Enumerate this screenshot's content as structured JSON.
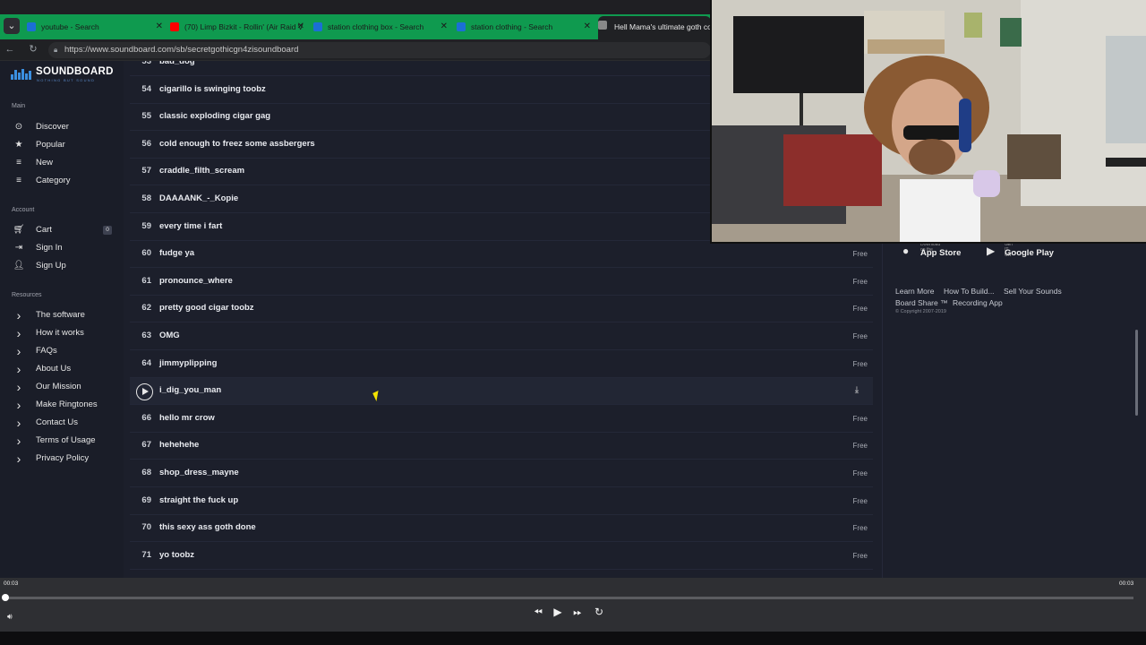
{
  "browser": {
    "tabs": [
      {
        "title": "youtube - Search",
        "color": "#1b6fd6"
      },
      {
        "title": "(70) Limp Bizkit - Rollin' (Air Raid V",
        "color": "#ff0000"
      },
      {
        "title": "station clothing box - Search",
        "color": "#1b6fd6"
      },
      {
        "title": "station clothing - Search",
        "color": "#1b6fd6"
      },
      {
        "title": "Hell Mama's ultimate goth cob",
        "color": "#888888"
      }
    ],
    "tab_close": "✕",
    "url": "https://www.soundboard.com/sb/secretgothicgn4zisoundboard"
  },
  "logo": {
    "word": "SOUNDBOARD",
    "tagline": "NOTHING BUT SOUND"
  },
  "sidebar": {
    "main_heading": "Main",
    "main": [
      {
        "label": "Discover",
        "icon": "compass-icon"
      },
      {
        "label": "Popular",
        "icon": "star-icon"
      },
      {
        "label": "New",
        "icon": "lines-icon"
      },
      {
        "label": "Category",
        "icon": "lines-icon"
      }
    ],
    "account_heading": "Account",
    "account": [
      {
        "label": "Cart",
        "icon": "cart-icon",
        "count": "0"
      },
      {
        "label": "Sign In",
        "icon": "sign-in-icon"
      },
      {
        "label": "Sign Up",
        "icon": "user-plus-icon"
      }
    ],
    "resources_heading": "Resources",
    "resources": [
      {
        "label": "The software"
      },
      {
        "label": "How it works"
      },
      {
        "label": "FAQs"
      },
      {
        "label": "About Us"
      },
      {
        "label": "Our Mission"
      },
      {
        "label": "Make Ringtones"
      },
      {
        "label": "Contact Us"
      },
      {
        "label": "Terms of Usage"
      },
      {
        "label": "Privacy Policy"
      }
    ]
  },
  "sounds": [
    {
      "num": "53",
      "name": "bad_dog",
      "price": ""
    },
    {
      "num": "54",
      "name": "cigarillo is swinging toobz",
      "price": ""
    },
    {
      "num": "55",
      "name": "classic exploding cigar gag",
      "price": ""
    },
    {
      "num": "56",
      "name": "cold enough to freez some assbergers",
      "price": ""
    },
    {
      "num": "57",
      "name": "craddle_filth_scream",
      "price": ""
    },
    {
      "num": "58",
      "name": "DAAAANK_-_Kopie",
      "price": ""
    },
    {
      "num": "59",
      "name": "every time i fart",
      "price": ""
    },
    {
      "num": "60",
      "name": "fudge ya",
      "price": "Free"
    },
    {
      "num": "61",
      "name": "pronounce_where",
      "price": "Free"
    },
    {
      "num": "62",
      "name": "pretty good cigar toobz",
      "price": "Free"
    },
    {
      "num": "63",
      "name": "OMG",
      "price": "Free"
    },
    {
      "num": "64",
      "name": "jimmyplipping",
      "price": "Free"
    },
    {
      "num": "",
      "name": "i_dig_you_man",
      "price": "",
      "hover": true
    },
    {
      "num": "66",
      "name": "hello mr crow",
      "price": "Free"
    },
    {
      "num": "67",
      "name": "hehehehe",
      "price": "Free"
    },
    {
      "num": "68",
      "name": "shop_dress_mayne",
      "price": "Free"
    },
    {
      "num": "69",
      "name": "straight the fuck up",
      "price": "Free"
    },
    {
      "num": "70",
      "name": "this sexy ass goth done",
      "price": "Free"
    },
    {
      "num": "71",
      "name": "yo toobz",
      "price": "Free"
    }
  ],
  "stores": [
    {
      "small": "Download on the",
      "big": "App Store",
      "icon": "apple-icon"
    },
    {
      "small": "GET IT ON",
      "big": "Google Play",
      "icon": "google-play-icon"
    }
  ],
  "footer": {
    "links_row1": [
      "Learn More",
      "How To Build...",
      "Sell Your Sounds"
    ],
    "links_row2": [
      "Board Share ™",
      "Recording App"
    ],
    "copyright": "© Copyright 2007-2019"
  },
  "player": {
    "current_time": "00:03",
    "total_time": "00:03",
    "progress": 0.0
  }
}
